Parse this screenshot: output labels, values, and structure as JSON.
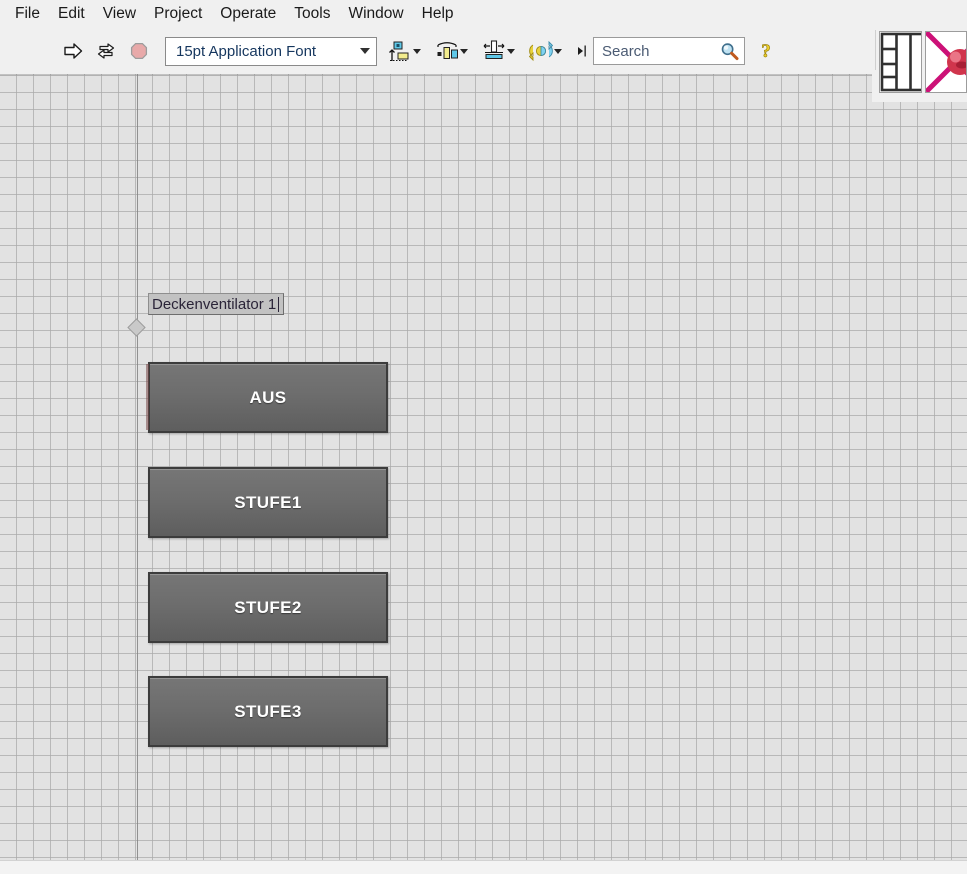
{
  "window": {
    "title": "Deckenventilator 1"
  },
  "menubar": {
    "items": [
      {
        "label": "File",
        "name": "menu-file"
      },
      {
        "label": "Edit",
        "name": "menu-edit"
      },
      {
        "label": "View",
        "name": "menu-view"
      },
      {
        "label": "Project",
        "name": "menu-project"
      },
      {
        "label": "Operate",
        "name": "menu-operate"
      },
      {
        "label": "Tools",
        "name": "menu-tools"
      },
      {
        "label": "Window",
        "name": "menu-window"
      },
      {
        "label": "Help",
        "name": "menu-help"
      }
    ]
  },
  "toolbar": {
    "run_icon": "run-arrow-icon",
    "run_continuously_icon": "run-continuously-icon",
    "abort_icon": "abort-execution-icon",
    "font_selector": {
      "value": "15pt Application Font",
      "caret": "chevron-down-icon"
    },
    "align_icon": "align-objects-icon",
    "distribute_icon": "distribute-objects-icon",
    "resize_icon": "resize-objects-icon",
    "reorder_icon": "reorder-objects-icon",
    "show_context_help_icon": "context-help-icon",
    "search": {
      "placeholder": "Search",
      "icon": "search-magnifier-icon",
      "expand_icon": "expand-search-icon"
    }
  },
  "corner": {
    "grid_thumb": "front-panel-icon",
    "connector_thumb": "connector-pane-icon"
  },
  "canvas": {
    "background_color": "#e2e2e2",
    "grid_color": "#aaaaaa",
    "grid_size_px": 17
  },
  "panel": {
    "label": {
      "text": "Deckenventilator 1",
      "editing": true
    },
    "buttons": [
      {
        "label": "AUS",
        "name": "button-aus",
        "selected": true
      },
      {
        "label": "STUFE1",
        "name": "button-stufe1",
        "selected": false
      },
      {
        "label": "STUFE2",
        "name": "button-stufe2",
        "selected": false
      },
      {
        "label": "STUFE3",
        "name": "button-stufe3",
        "selected": false
      }
    ],
    "button_style": {
      "fill_top": "#767676",
      "fill_bottom": "#5e5e5e",
      "border_color": "#3c3c3c",
      "text_color": "#ffffff"
    }
  }
}
